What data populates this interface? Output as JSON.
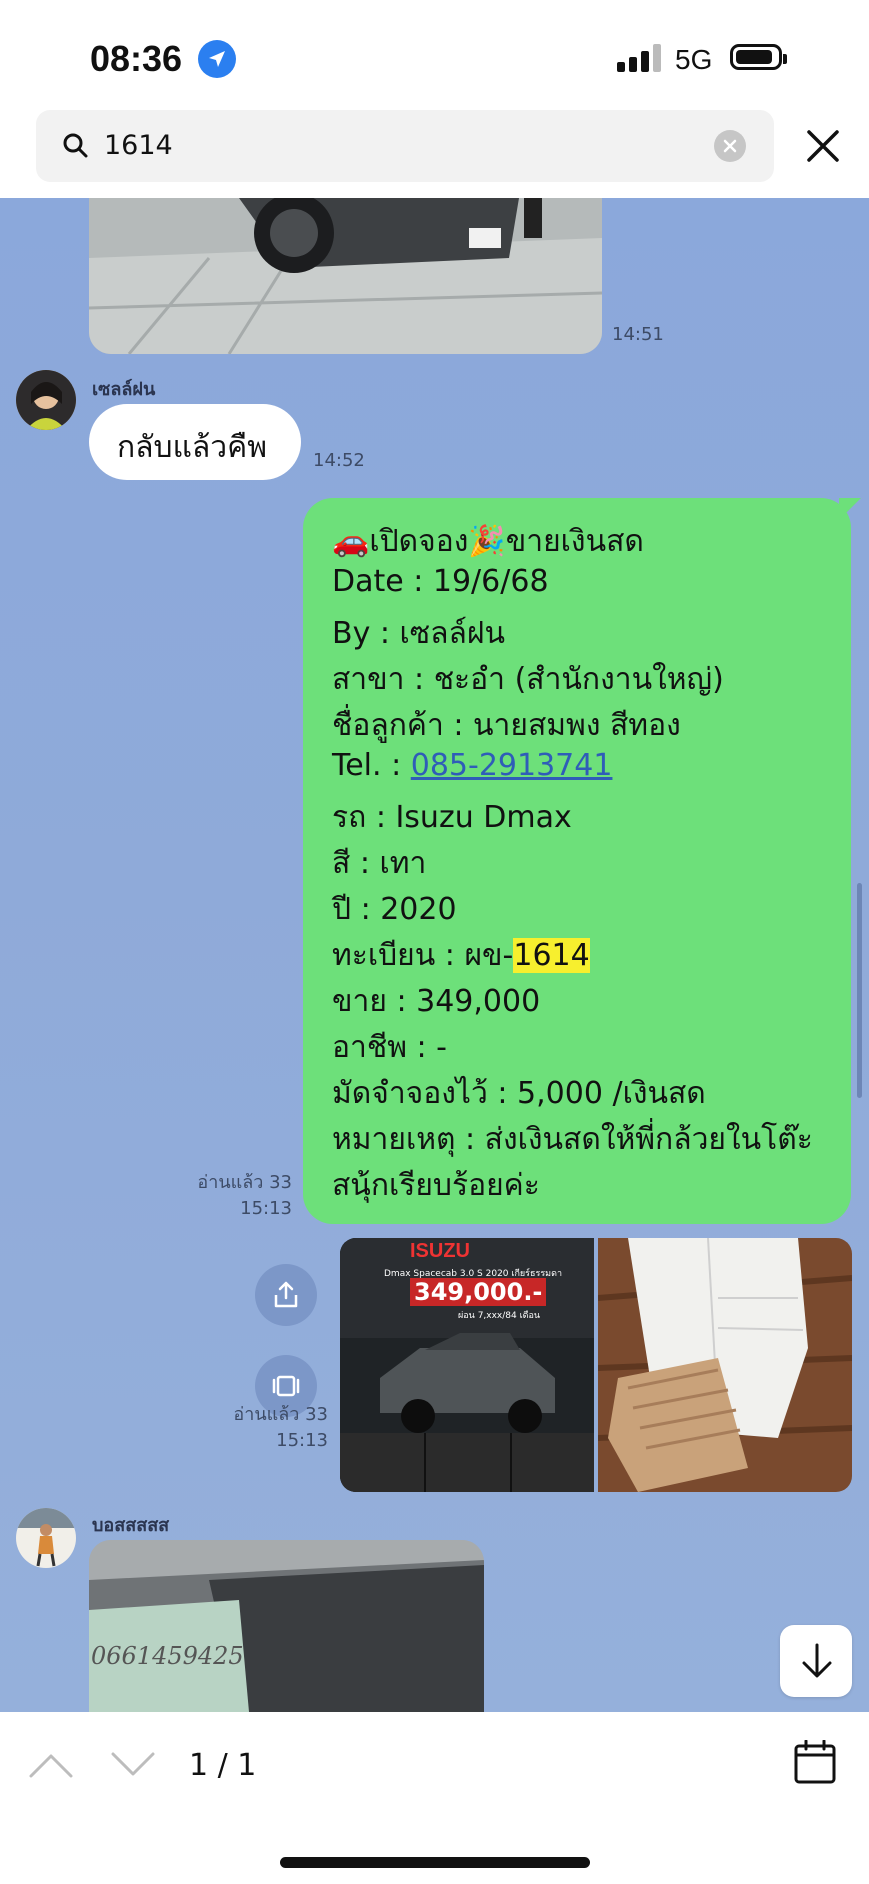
{
  "status": {
    "time": "08:36",
    "network": "5G"
  },
  "search": {
    "query": "1614"
  },
  "messages": {
    "top_image_time": "14:51",
    "sender1": {
      "name": "เซลล์ฝน",
      "text": "กลับแล้วคืพ",
      "time": "14:52"
    },
    "green": {
      "title": "🚗เปิดจอง🎉ขายเงินสด",
      "date": "Date : 19/6/68",
      "by": "By : เซลล์ฝน",
      "branch": "สาขา : ชะอำ (สำนักงานใหญ่)",
      "customer": "ชื่อลูกค้า : นายสมพง สีทอง",
      "tel_prefix": "Tel. : ",
      "tel": "085-2913741",
      "car": "รถ : Isuzu Dmax",
      "color": "สี : เทา",
      "year": "ปี : 2020",
      "plate_prefix": "ทะเบียน : ผข-",
      "plate_highlight": "1614",
      "price": "ขาย : 349,000",
      "job": "อาชีพ : -",
      "deposit": "มัดจำจองไว้ : 5,000 /เงินสด",
      "note1": "หมายเหตุ : ส่งเงินสดให้พี่กล้วยในโต๊ะ",
      "note2": "สนุ้กเรียบร้อยค่ะ",
      "read": "อ่านแล้ว 33",
      "time": "15:13"
    },
    "photos": {
      "brand": "ISUZU",
      "caption": "Dmax Spacecab 3.0 S 2020 เกียร์ธรรมดา",
      "price": "349,000.-",
      "installment": "ผ่อน 7,xxx/84 เดือน",
      "read": "อ่านแล้ว 33",
      "time": "15:13"
    },
    "sender2": {
      "name": "บอสสสสส",
      "note_text": "0661459425"
    }
  },
  "bottom": {
    "counter": "1 / 1"
  }
}
